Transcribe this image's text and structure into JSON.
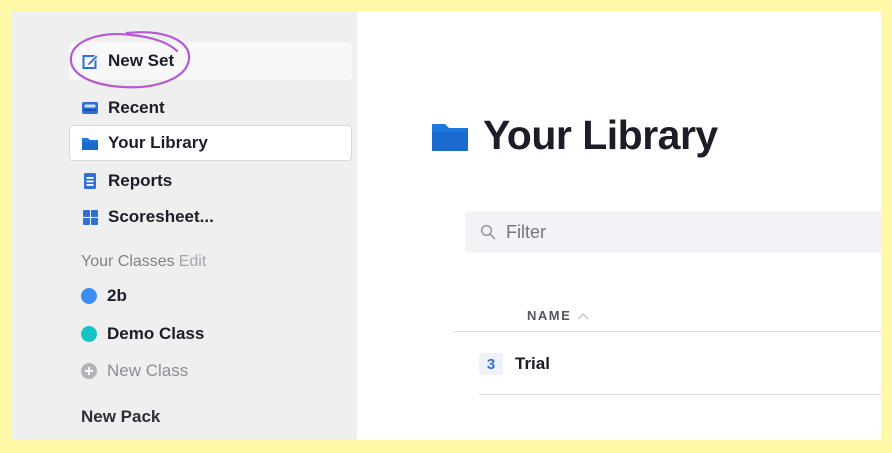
{
  "sidebar": {
    "new_set": "New Set",
    "recent": "Recent",
    "your_library": "Your Library",
    "reports": "Reports",
    "scoresheet": "Scoresheet...",
    "classes_label": "Your Classes",
    "classes_edit": "Edit",
    "classes": [
      {
        "name": "2b",
        "color": "#3a8ef0"
      },
      {
        "name": "Demo Class",
        "color": "#17c2c2"
      }
    ],
    "new_class": "New Class",
    "new_pack": "New Pack"
  },
  "main": {
    "title": "Your Library",
    "filter_placeholder": "Filter",
    "column_name": "NAME",
    "rows": [
      {
        "count": "3",
        "name": "Trial"
      }
    ]
  },
  "colors": {
    "accent": "#2c71d1",
    "highlight": "#fff8a6",
    "annotation_circle": "#b35ad4"
  },
  "icons": [
    "edit-icon",
    "recent-icon",
    "folder-icon",
    "reports-icon",
    "scoresheet-icon",
    "search-icon",
    "sort-ascending-icon"
  ]
}
